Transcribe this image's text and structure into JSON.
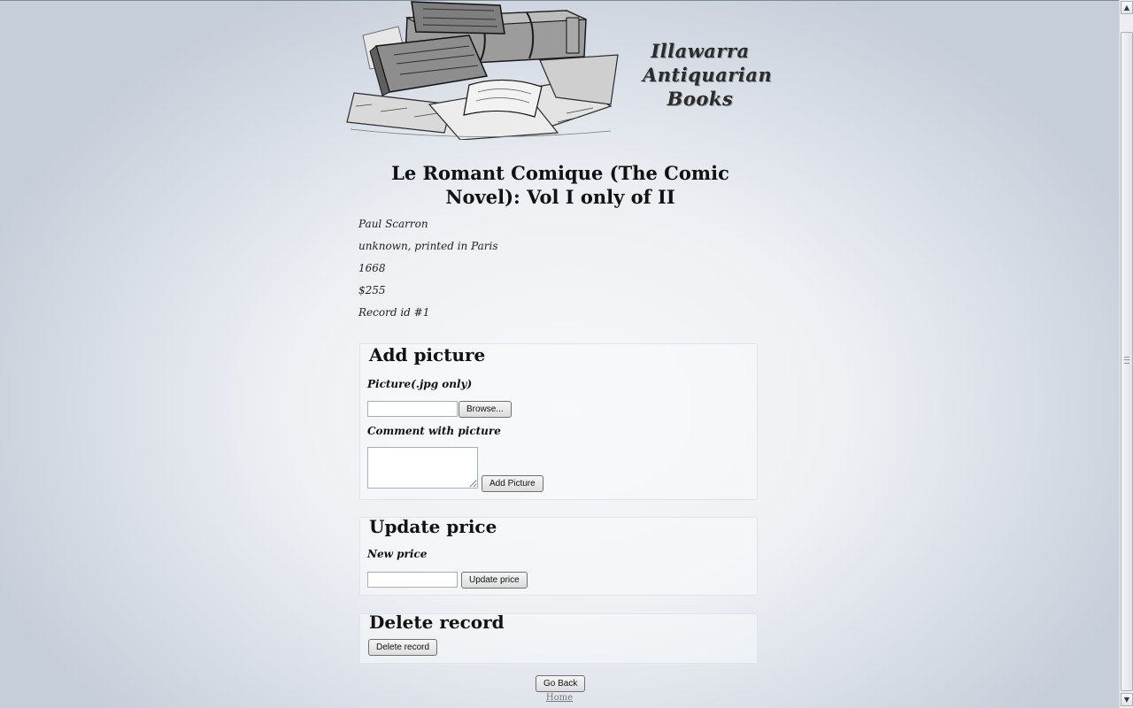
{
  "header": {
    "logo_lines": [
      "Illawarra",
      "Antiquarian",
      "Books"
    ]
  },
  "book": {
    "title": "Le Romant Comique (The Comic Novel): Vol I only of II",
    "author": "Paul Scarron",
    "publisher": "unknown, printed in Paris",
    "year": "1668",
    "price": "$255",
    "record": "Record id #1"
  },
  "add_picture": {
    "legend": "Add picture",
    "picture_label": "Picture(.jpg only)",
    "browse_label": "Browse...",
    "comment_label": "Comment with picture",
    "submit_label": "Add Picture"
  },
  "update_price": {
    "legend": "Update price",
    "new_price_label": "New price",
    "submit_label": "Update price"
  },
  "delete_record": {
    "legend": "Delete record",
    "submit_label": "Delete record"
  },
  "footer": {
    "go_back_label": "Go Back",
    "home_link": "Home"
  },
  "colors": {
    "background_center": "#f7f8fa",
    "background_edge": "#c6ced9",
    "text": "#111111",
    "link": "#777777"
  }
}
